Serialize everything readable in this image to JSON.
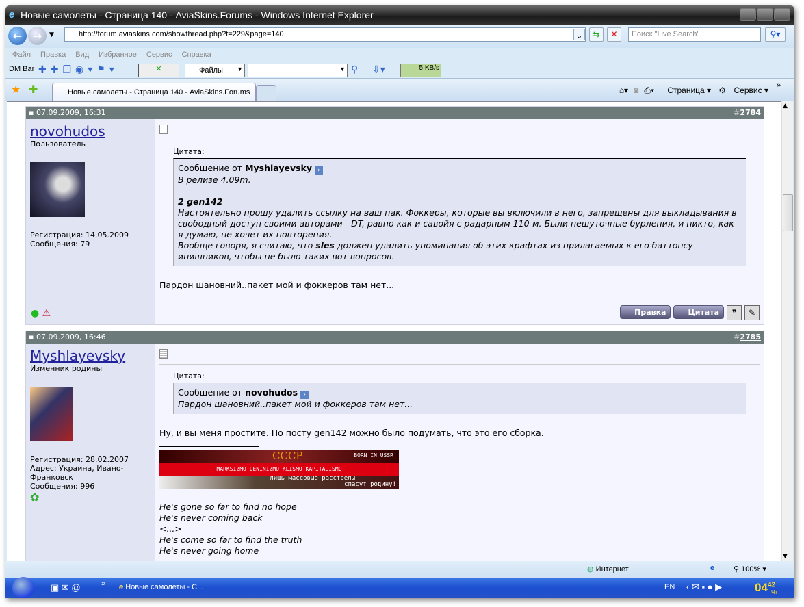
{
  "window": {
    "title": "Новые самолеты - Страница 140 - AviaSkins.Forums - Windows Internet Explorer"
  },
  "address": {
    "url": "http://forum.aviaskins.com/showthread.php?t=229&page=140",
    "search_placeholder": "Поиск \"Live Search\""
  },
  "menu": [
    "Файл",
    "Правка",
    "Вид",
    "Избранное",
    "Сервис",
    "Справка"
  ],
  "dmbar": {
    "label": "DM Bar",
    "files": "Файлы",
    "speed": "5 KB/s"
  },
  "tab": {
    "label": "Новые самолеты - Страница 140 - AviaSkins.Forums"
  },
  "commands": {
    "page": "Страница",
    "tools": "Сервис",
    "more": "»"
  },
  "posts": [
    {
      "date": "07.09.2009, 16:31",
      "number_prefix": "#",
      "number": "2784",
      "username": "novohudos",
      "rank": "Пользователь",
      "reg": "Регистрация: 14.05.2009",
      "posts": "Сообщения: 79",
      "quote_label": "Цитата:",
      "quote_from_prefix": "Сообщение от ",
      "quote_author": "Myshlayevsky",
      "quote_lines": [
        "В релизе 4.09m."
      ],
      "quote_bold": "2 gen142",
      "quote_para": "Настоятельно прошу удалить ссылку на ваш пак. Фоккеры, которые вы включили в него, запрещены для выкладывания в свободный доступ своими авторами - DT, равно как и савойя с радарным 110-м. Были нешуточные бурления, и никто, как я думаю, не хочет их повторения.",
      "quote_p2a": "Вообще говоря, я считаю, что ",
      "quote_p2b": "sles",
      "quote_p2c": " должен удалить упоминания об этих крафтах из прилагаемых к его баттонсу инишников, чтобы не было таких вот вопросов.",
      "text": "Пардон шановний..пакет мой и фоккеров там нет...",
      "buttons": {
        "edit": "Правка",
        "quote": "Цитата"
      }
    },
    {
      "date": "07.09.2009, 16:46",
      "number_prefix": "#",
      "number": "2785",
      "username": "Myshlayevsky",
      "rank": "Изменник родины",
      "reg": "Регистрация: 28.02.2007",
      "addr": "Адрес: Украина, Ивано-Франковск",
      "posts": "Сообщения: 996",
      "quote_label": "Цитата:",
      "quote_from_prefix": "Сообщение от ",
      "quote_author": "novohudos",
      "quote_text": "Пардон шановний..пакет мой и фоккеров там нет...",
      "text": "Ну, и вы меня простите. По посту gen142 можно было подумать, что это его сборка.",
      "banner": {
        "title": "СССР",
        "tag": "BORN IN USSR",
        "slogan": "MARKSIZMO LENINIZMO KLISMO KAPITALISMO",
        "line1": "лишь массовые расстрелы",
        "line2": "спасут родину!"
      },
      "lyrics": [
        "He's gone so far to find no hope",
        "He's never coming back",
        "<...>",
        "He's come so far to find the truth",
        "He's never going home"
      ]
    }
  ],
  "status": {
    "zone": "Интернет",
    "zoom": "100%"
  },
  "taskbar": {
    "task": "Новые самолеты - С...",
    "lang": "EN",
    "clock_h": "04",
    "clock_m": "42",
    "day": "Чт",
    "chev": "»"
  }
}
